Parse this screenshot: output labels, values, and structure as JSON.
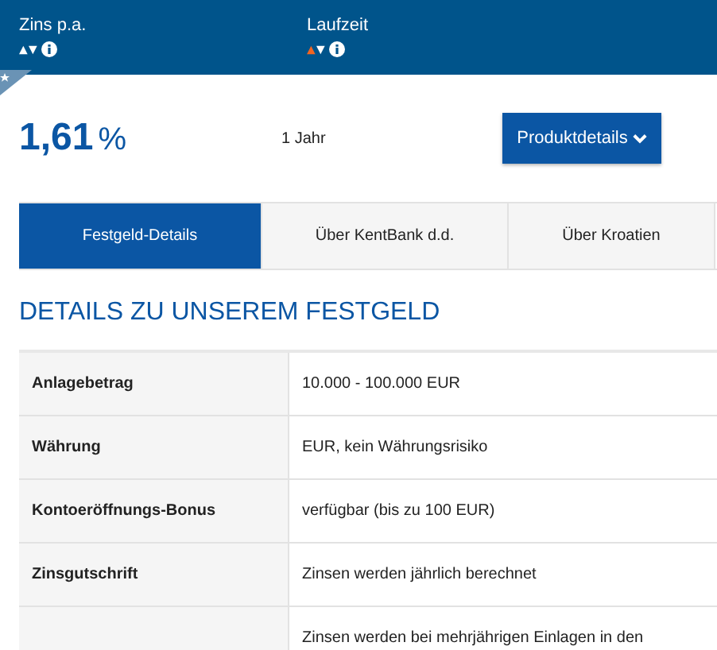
{
  "header": {
    "columns": [
      {
        "label": "Zins p.a.",
        "sorted": false
      },
      {
        "label": "Laufzeit",
        "sorted": true
      }
    ]
  },
  "offer": {
    "rate": "1,61",
    "unit": "%",
    "term": "1 Jahr",
    "button": "Produktdetails"
  },
  "tabs": [
    {
      "label": "Festgeld-Details",
      "selected": true
    },
    {
      "label": "Über KentBank d.d.",
      "selected": false
    },
    {
      "label": "Über Kroatien",
      "selected": false
    }
  ],
  "heading": "DETAILS ZU UNSEREM FESTGELD",
  "table": {
    "rows": [
      {
        "label": "Anlagebetrag",
        "value": "10.000 - 100.000 EUR"
      },
      {
        "label": "Währung",
        "value": "EUR, kein Währungsrisiko"
      },
      {
        "label": "Kontoeröffnungs-Bonus",
        "value": "verfügbar (bis zu 100 EUR)"
      },
      {
        "label": "Zinsgutschrift",
        "value": "Zinsen werden jährlich berechnet"
      },
      {
        "label": "",
        "value": "Zinsen werden bei mehrjährigen Einlagen in den"
      }
    ]
  }
}
